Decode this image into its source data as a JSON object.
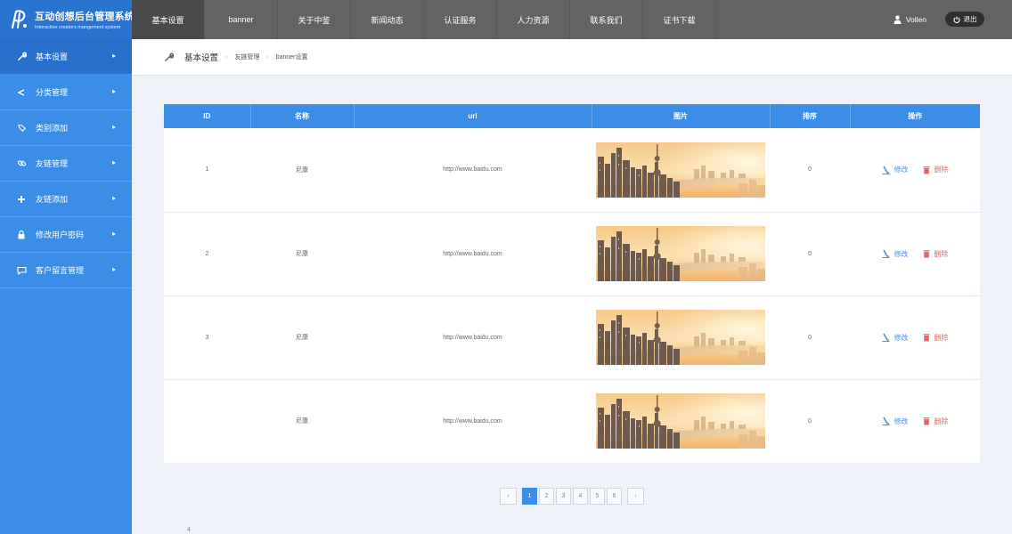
{
  "app": {
    "title": "互动创想后台管理系统",
    "subtitle": "Interactive creators mangement system"
  },
  "sidebar": {
    "items": [
      {
        "label": "基本设置",
        "icon": "wrench-icon",
        "active": true
      },
      {
        "label": "分类管理",
        "icon": "share-icon",
        "active": false
      },
      {
        "label": "类别添加",
        "icon": "tag-icon",
        "active": false
      },
      {
        "label": "友链管理",
        "icon": "link-icon",
        "active": false
      },
      {
        "label": "友链添加",
        "icon": "plus-icon",
        "active": false
      },
      {
        "label": "修改用户密码",
        "icon": "lock-icon",
        "active": false
      },
      {
        "label": "客户留言管理",
        "icon": "comment-icon",
        "active": false
      }
    ]
  },
  "topnav": {
    "tabs": [
      "基本设置",
      "banner",
      "关于中鉴",
      "新闻动态",
      "认证服务",
      "人力资源",
      "联系我们",
      "证书下载"
    ],
    "active_index": 0
  },
  "user": {
    "name": "Vollen",
    "logout_label": "退出"
  },
  "breadcrumb": {
    "main": "基本设置",
    "items": [
      "友链管理",
      "banner设置"
    ]
  },
  "table": {
    "headers": [
      "ID",
      "名称",
      "url",
      "图片",
      "排序",
      "操作"
    ],
    "rows": [
      {
        "id": "1",
        "name": "尼康",
        "url": "http://www.baidu.com",
        "sort": "0",
        "edit": "修改",
        "delete": "删除"
      },
      {
        "id": "2",
        "name": "尼康",
        "url": "http://www.baidu.com",
        "sort": "0",
        "edit": "修改",
        "delete": "删除"
      },
      {
        "id": "3",
        "name": "尼康",
        "url": "http://www.baidu.com",
        "sort": "0",
        "edit": "修改",
        "delete": "删除"
      },
      {
        "id": "",
        "name": "尼康",
        "url": "http://www.baidu.com",
        "sort": "0",
        "edit": "修改",
        "delete": "删除"
      }
    ]
  },
  "pagination": {
    "prev": "‹",
    "next": "›",
    "pages": [
      "1",
      "2",
      "3",
      "4",
      "5",
      "6"
    ],
    "current": "1"
  },
  "footer": {
    "stray_text": "4"
  },
  "colors": {
    "sidebar": "#3c8de8",
    "sidebar_active": "#2a6fcc",
    "topbar": "#636363",
    "table_header": "#3c8de8",
    "edit": "#4a8fdc",
    "delete": "#e86565"
  }
}
